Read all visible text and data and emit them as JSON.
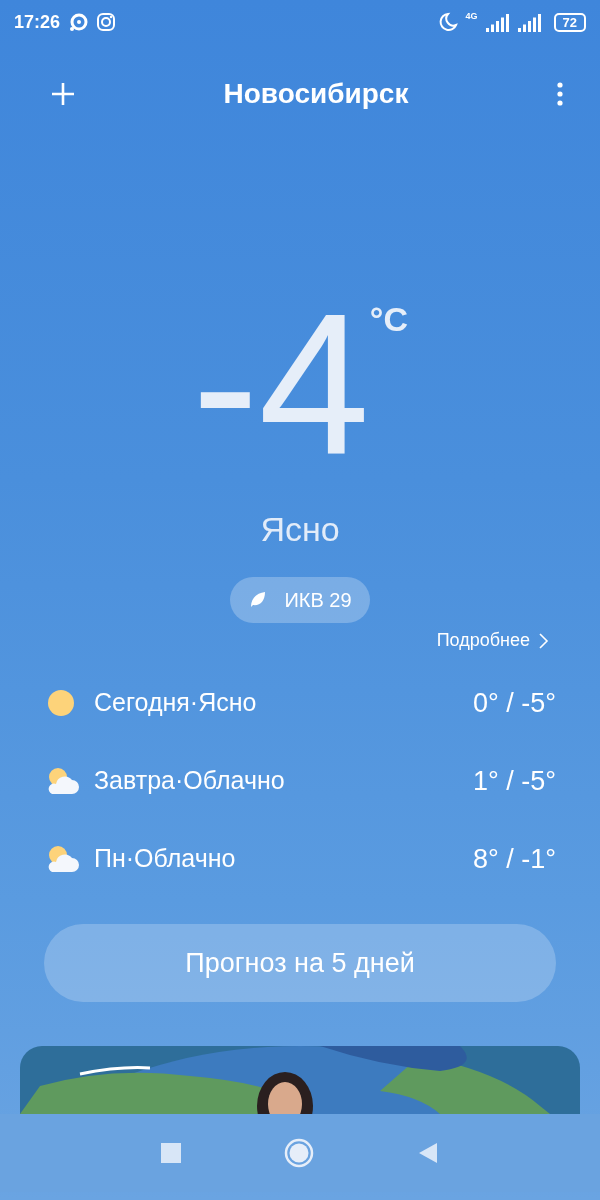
{
  "status_bar": {
    "time": "17:26",
    "network": "4G",
    "battery": "72"
  },
  "header": {
    "city": "Новосибирск"
  },
  "current": {
    "temperature": "-4",
    "unit": "°C",
    "condition": "Ясно",
    "aqi": "ИКВ 29",
    "details_link": "Подробнее"
  },
  "forecast": [
    {
      "kind": "sun",
      "label": "Сегодня·Ясно",
      "range": "0° / -5°"
    },
    {
      "kind": "partly-cloudy",
      "label": "Завтра·Облачно",
      "range": "1° / -5°"
    },
    {
      "kind": "partly-cloudy",
      "label": "Пн·Облачно",
      "range": "8° / -1°"
    }
  ],
  "forecast_button": "Прогноз на 5 дней"
}
